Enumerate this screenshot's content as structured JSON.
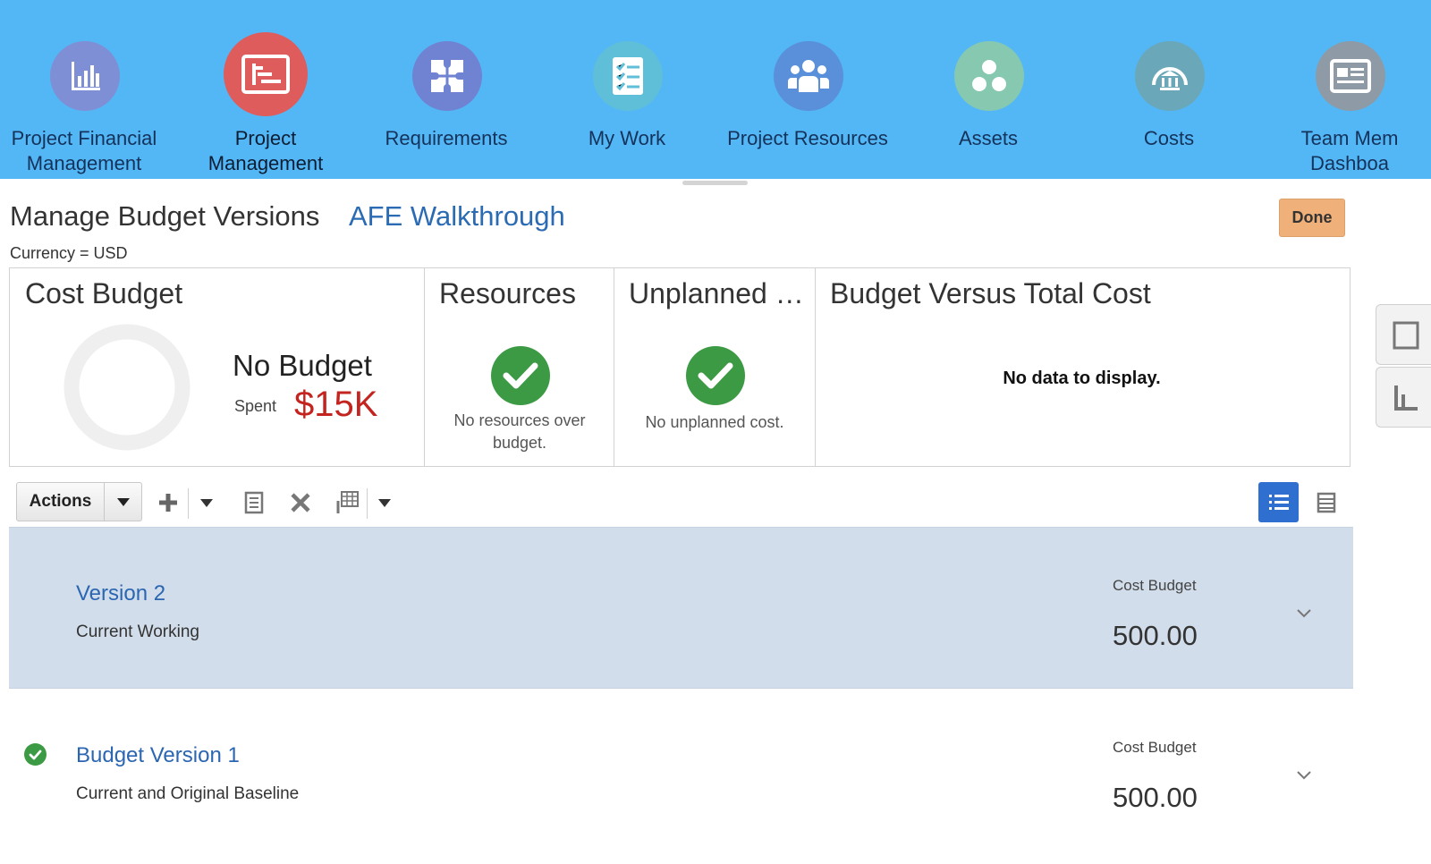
{
  "nav": {
    "items": [
      {
        "label": "Project Financial\nManagement",
        "icon": "bar-chart-icon",
        "color": "#7f8fd6"
      },
      {
        "label": "Project\nManagement",
        "icon": "gantt-icon",
        "color": "#de5c5c",
        "selected": true
      },
      {
        "label": "Requirements",
        "icon": "puzzle-icon",
        "color": "#6f83d2"
      },
      {
        "label": "My Work",
        "icon": "checklist-icon",
        "color": "#5fbfd9"
      },
      {
        "label": "Project Resources",
        "icon": "team-icon",
        "color": "#5a8fda"
      },
      {
        "label": "Assets",
        "icon": "assets-icon",
        "color": "#86c9b0"
      },
      {
        "label": "Costs",
        "icon": "bank-icon",
        "color": "#6aa7b8"
      },
      {
        "label": "Team Mem\nDashboa",
        "icon": "dashboard-icon",
        "color": "#8e9aa6"
      }
    ]
  },
  "page": {
    "title": "Manage Budget Versions",
    "subtitle": "AFE Walkthrough",
    "currency": "Currency = USD",
    "done_label": "Done"
  },
  "summary": {
    "cost_budget": {
      "title": "Cost Budget",
      "status": "No Budget",
      "spent_label": "Spent",
      "spent_value": "$15K"
    },
    "resources": {
      "title": "Resources",
      "note": "No resources over budget."
    },
    "unplanned": {
      "title": "Unplanned Cost",
      "note": "No unplanned cost."
    },
    "budget_vs_cost": {
      "title": "Budget Versus Total Cost",
      "empty": "No data to display."
    }
  },
  "toolbar": {
    "actions_label": "Actions"
  },
  "versions": [
    {
      "name": "Version 2",
      "status": "Current Working",
      "metric_label": "Cost Budget",
      "metric_value": "500.00",
      "selected": true,
      "baseline": false
    },
    {
      "name": "Budget Version 1",
      "status": "Current and Original Baseline",
      "metric_label": "Cost Budget",
      "metric_value": "500.00",
      "selected": false,
      "baseline": true
    }
  ],
  "colors": {
    "nav_band": "#53b7f6",
    "link": "#2a66b1",
    "spent": "#c4241f",
    "success": "#3d9a44",
    "done_button": "#f0b07a",
    "selected_row": "#d1ddea",
    "view_active": "#2f6fd0"
  }
}
